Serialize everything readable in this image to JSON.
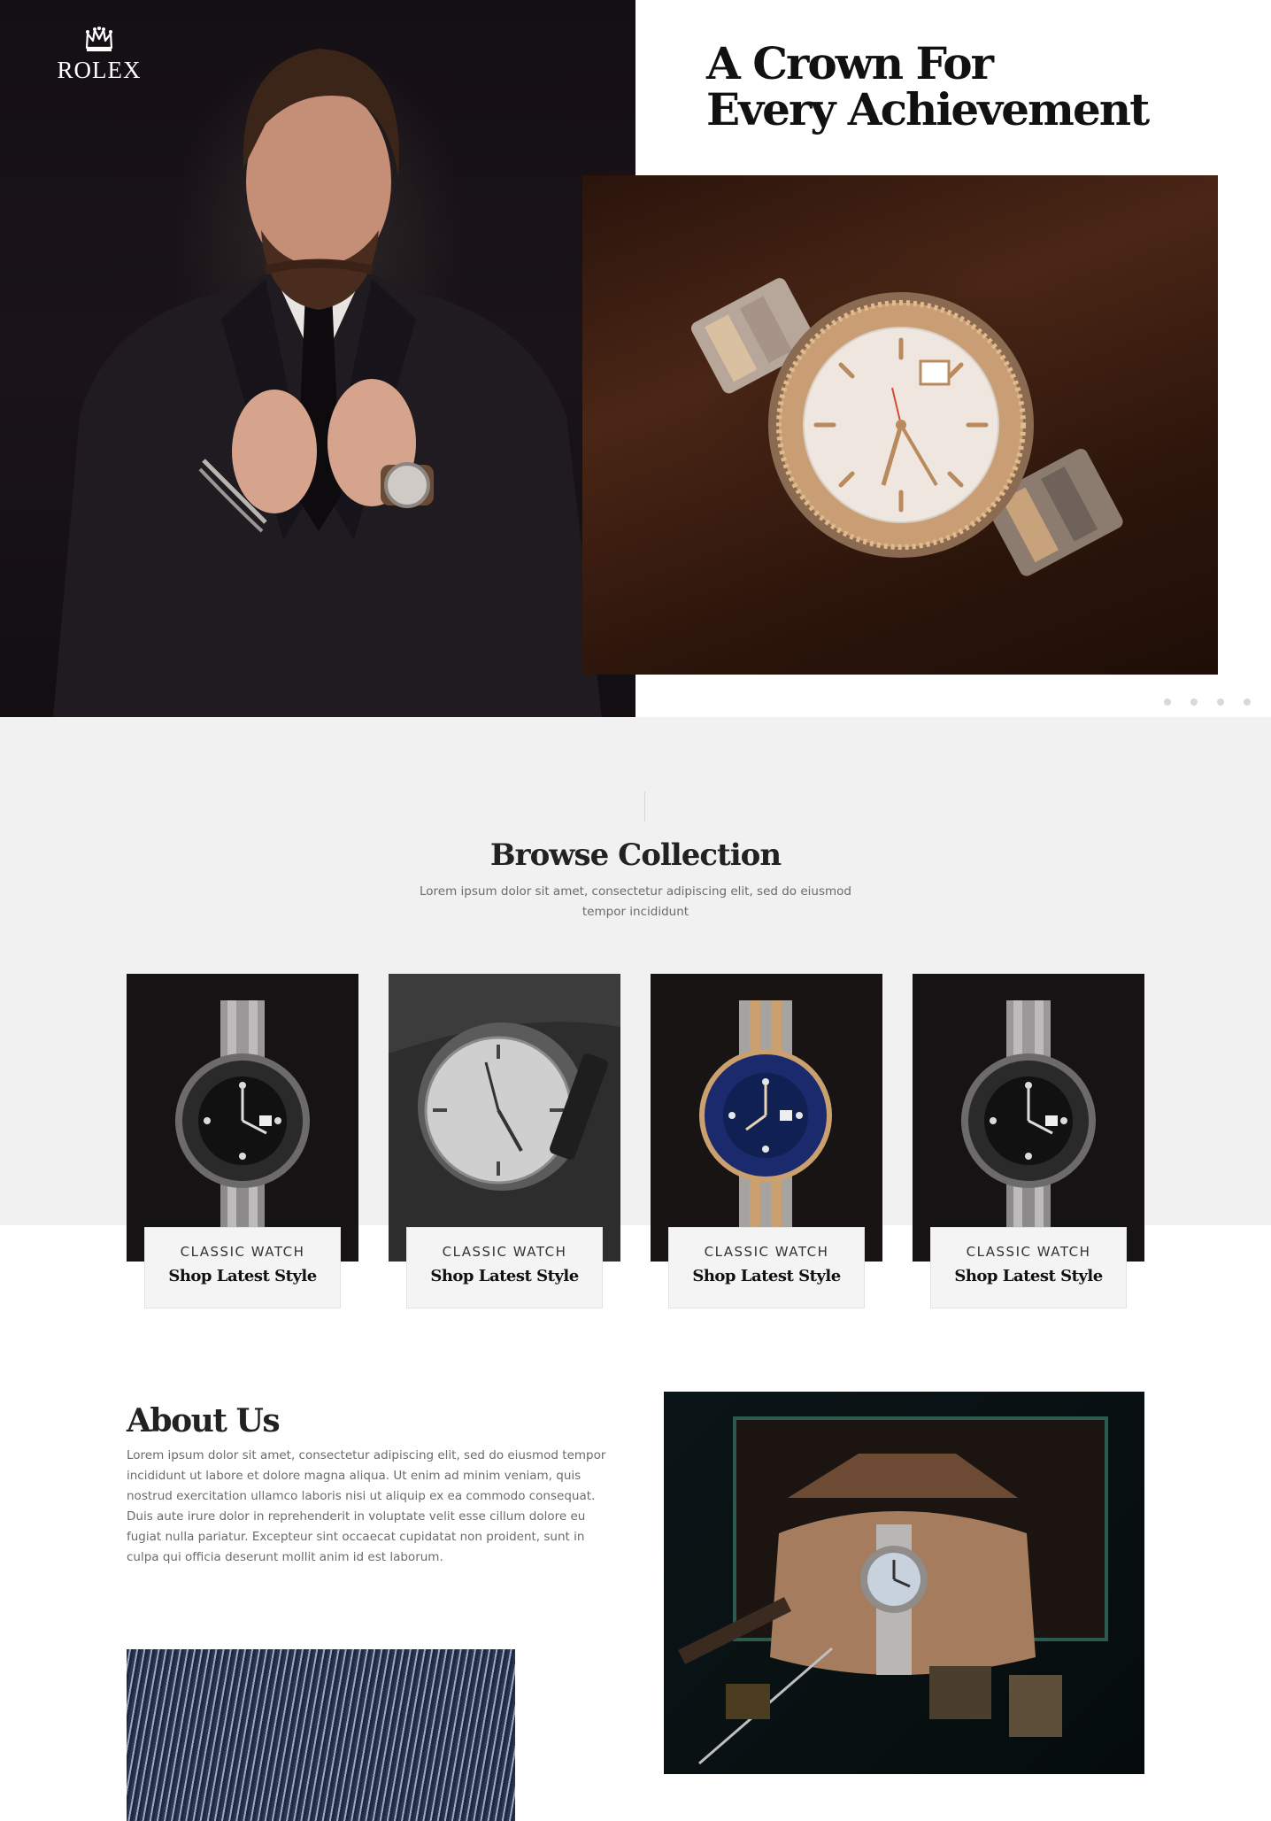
{
  "brand": {
    "name": "ROLEX"
  },
  "hero": {
    "title_line1": "A Crown For",
    "title_line2": "Every Achievement"
  },
  "collection": {
    "title": "Browse Collection",
    "subtitle": "Lorem ipsum dolor sit amet, consectetur adipiscing elit, sed do eiusmod tempor incididunt",
    "cards": [
      {
        "kicker": "CLASSIC WATCH",
        "link": "Shop Latest Style"
      },
      {
        "kicker": "CLASSIC WATCH",
        "link": "Shop Latest Style"
      },
      {
        "kicker": "CLASSIC WATCH",
        "link": "Shop Latest Style"
      },
      {
        "kicker": "CLASSIC WATCH",
        "link": "Shop Latest Style"
      }
    ]
  },
  "about": {
    "title": "About Us",
    "body": "Lorem ipsum dolor sit amet, consectetur adipiscing elit, sed do eiusmod tempor incididunt ut labore et dolore magna aliqua. Ut enim ad minim veniam, quis nostrud exercitation ullamco laboris nisi ut aliquip ex ea commodo consequat. Duis aute irure dolor in reprehenderit in voluptate velit esse cillum dolore eu fugiat nulla pariatur. Excepteur sint occaecat cupidatat non proident, sunt in culpa qui officia deserunt mollit anim id est laborum."
  },
  "icons": {
    "logo": "crown-icon"
  },
  "colors": {
    "dark": "#140f14",
    "accent_brown": "#4a2616",
    "light_section": "#f1f1f1",
    "text_muted": "#6b6b6b"
  }
}
